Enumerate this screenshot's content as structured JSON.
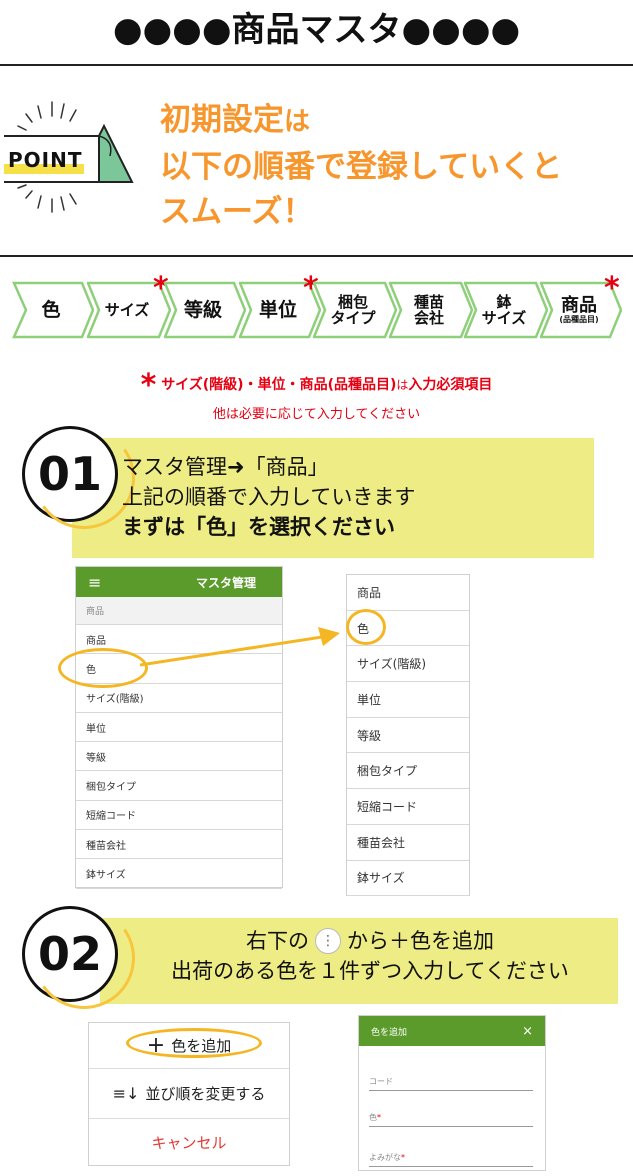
{
  "title": "●●●●商品マスタ●●●●",
  "point": {
    "badge_label": "POINT",
    "line1_a": "初期設定",
    "line1_b": "は",
    "line2": "以下の順番で登録していくと",
    "line3": "スムーズ！"
  },
  "steps": [
    {
      "line1": "色",
      "line2": "",
      "required": false
    },
    {
      "line1": "サイズ",
      "line2": "",
      "required": true
    },
    {
      "line1": "等級",
      "line2": "",
      "required": false
    },
    {
      "line1": "単位",
      "line2": "",
      "required": true
    },
    {
      "line1": "梱包",
      "line2": "タイプ",
      "required": false
    },
    {
      "line1": "種苗",
      "line2": "会社",
      "required": false
    },
    {
      "line1": "鉢",
      "line2": "サイズ",
      "required": false
    },
    {
      "line1": "商品",
      "line2": "(品種品目)",
      "required": true
    }
  ],
  "note": {
    "star": "*",
    "bold_a": "サイズ(階級)・単位・商品(品種品目)",
    "mid": "は",
    "bold_b": "入力必須項目",
    "line2": "他は必要に応じて入力してください"
  },
  "section1": {
    "number": "01",
    "line1": "マスタ管理➜「商品」",
    "line2": "上記の順番で入力していきます",
    "line3": "まずは「色」を選択ください"
  },
  "left_menu": {
    "header_icon": "hamburger-icon",
    "header_title": "マスタ管理",
    "section_label": "商品",
    "items": [
      "商品",
      "色",
      "サイズ(階級)",
      "単位",
      "等級",
      "梱包タイプ",
      "短縮コード",
      "種苗会社",
      "鉢サイズ"
    ]
  },
  "right_menu": {
    "items": [
      "商品",
      "色",
      "サイズ(階級)",
      "単位",
      "等級",
      "梱包タイプ",
      "短縮コード",
      "種苗会社",
      "鉢サイズ"
    ]
  },
  "section2": {
    "number": "02",
    "line1_a": "右下の",
    "line1_b": "から＋色を追加",
    "line2": "出荷のある色を１件ずつ入力してください"
  },
  "action_sheet": {
    "add_label": "色を追加",
    "sort_label": "並び順を変更する",
    "cancel_label": "キャンセル"
  },
  "dialog": {
    "title": "色を追加",
    "close": "×",
    "field_code": "コード",
    "field_color": "色",
    "field_kana": "よみがな",
    "required_mark": "*"
  },
  "colors": {
    "accent_orange": "#f7962c",
    "banner_yellow": "#eeec84",
    "header_green": "#5b9b2b",
    "step_green": "#8ed07a",
    "required_red": "#e60012",
    "highlight": "#f5b623"
  }
}
